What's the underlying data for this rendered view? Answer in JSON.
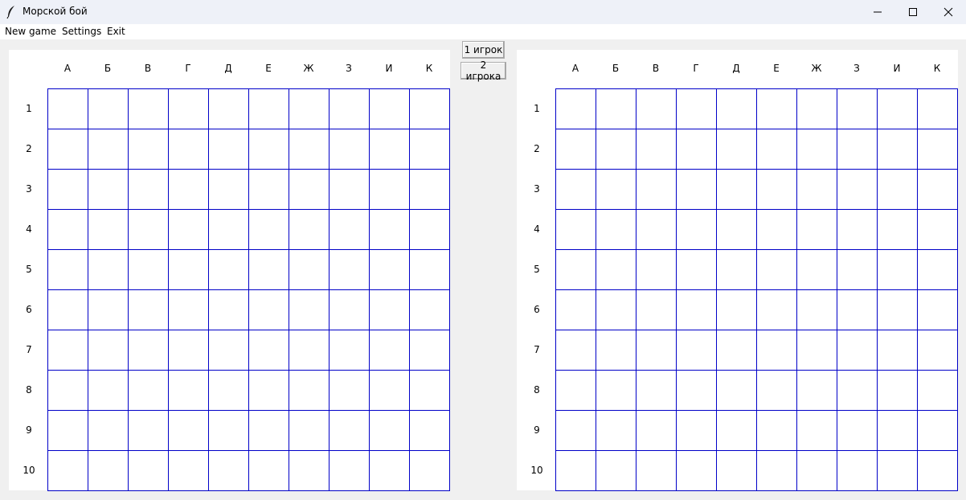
{
  "window": {
    "title": "Морской бой",
    "icon": "feather-icon"
  },
  "menu": {
    "items": [
      "New game",
      "Settings",
      "Exit"
    ]
  },
  "mode_buttons": {
    "one_player": "1 игрок",
    "two_players": "2 игрока"
  },
  "board": {
    "columns": [
      "А",
      "Б",
      "В",
      "Г",
      "Д",
      "Е",
      "Ж",
      "З",
      "И",
      "К"
    ],
    "rows": [
      "1",
      "2",
      "3",
      "4",
      "5",
      "6",
      "7",
      "8",
      "9",
      "10"
    ],
    "grid_color": "#0000c8"
  }
}
